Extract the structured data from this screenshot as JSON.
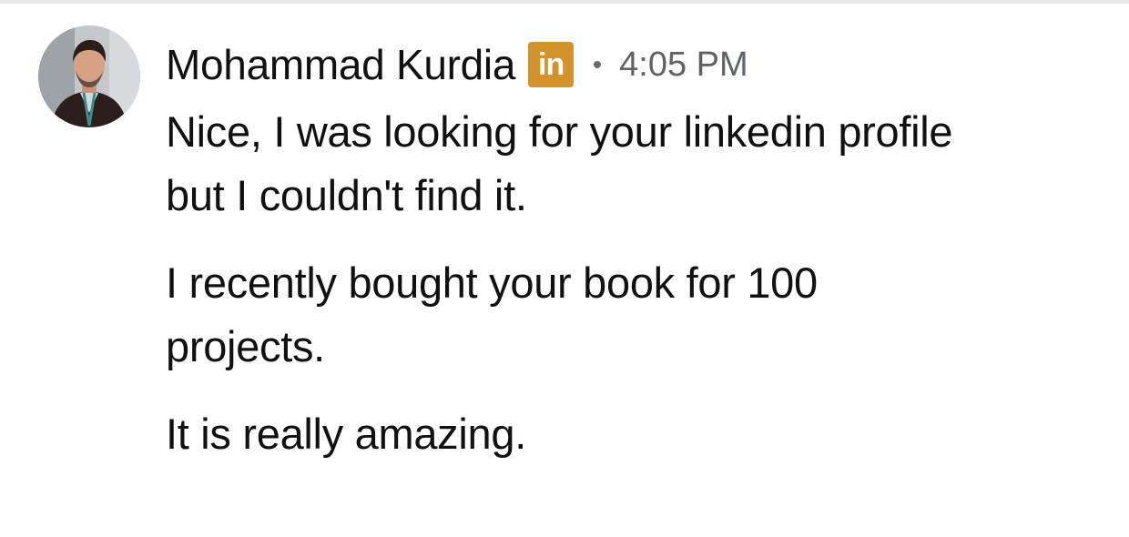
{
  "message": {
    "sender_name": "Mohammad Kurdia",
    "badge_text": "in",
    "badge_icon": "linkedin-icon",
    "badge_color": "#d4922a",
    "separator": "•",
    "timestamp": "4:05 PM",
    "paragraphs": [
      "Nice, I was looking for your linkedin profile but I couldn't find it.",
      "I recently bought your book for 100 projects.",
      "It is really amazing."
    ]
  }
}
